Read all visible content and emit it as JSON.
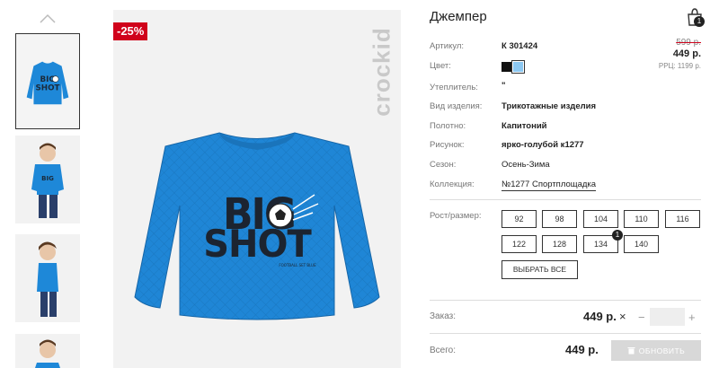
{
  "product": {
    "title": "Джемпер",
    "discount_badge": "-25%",
    "brand_watermark": "crockid",
    "cart_count": "1",
    "prices": {
      "old": "599 р.",
      "new": "449 р.",
      "rrp": "РРЦ: 1199 р."
    }
  },
  "attributes": [
    {
      "label": "Артикул:",
      "value": "К 301424"
    },
    {
      "label": "Цвет:",
      "value": ""
    },
    {
      "label": "Утеплитель:",
      "value": "\""
    },
    {
      "label": "Вид изделия:",
      "value": "Трикотажные изделия"
    },
    {
      "label": "Полотно:",
      "value": "Капитоний"
    },
    {
      "label": "Рисунок:",
      "value": "ярко-голубой к1277"
    },
    {
      "label": "Сезон:",
      "value": "Осень-Зима"
    },
    {
      "label": "Коллекция:",
      "value": "№1277 Спортплощадка"
    }
  ],
  "colors": [
    "#111111",
    "#8cc8f2"
  ],
  "sizes": {
    "label": "Рост/размер:",
    "options": [
      "92",
      "98",
      "104",
      "110",
      "116",
      "122",
      "128",
      "134",
      "140"
    ],
    "selected_badge": "1",
    "select_all": "ВЫБРАТЬ ВСЕ"
  },
  "order": {
    "label": "Заказ:",
    "price": "449 р.",
    "remove": "×",
    "minus": "−",
    "plus": "+",
    "qty": ""
  },
  "total": {
    "label": "Всего:",
    "price": "449 р.",
    "update": "ОБНОВИТЬ"
  },
  "print": {
    "line1": "BIG",
    "line2": "SHOT",
    "small": "FOOTBALL SET BLUE"
  }
}
